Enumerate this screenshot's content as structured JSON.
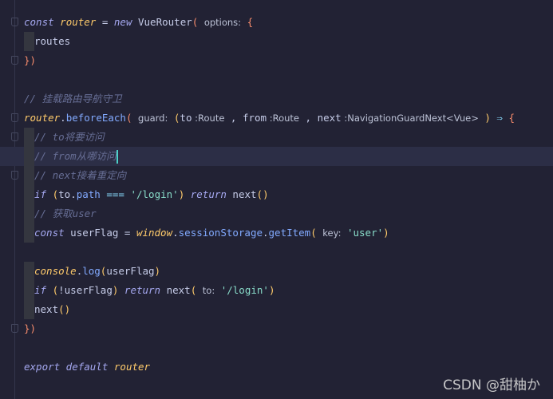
{
  "editor": {
    "lines": [
      {
        "indent": false,
        "fold": true,
        "tokens": [
          {
            "t": "const",
            "c": "kw"
          },
          {
            "t": " ",
            "c": "pl"
          },
          {
            "t": "router",
            "c": "var"
          },
          {
            "t": " = ",
            "c": "pl"
          },
          {
            "t": "new",
            "c": "kw"
          },
          {
            "t": " VueRouter",
            "c": "pl"
          },
          {
            "t": "( ",
            "c": "pn"
          },
          {
            "t": "options:",
            "c": "hint"
          },
          {
            "t": " {",
            "c": "pn"
          }
        ]
      },
      {
        "indent": true,
        "guide": true,
        "tokens": [
          {
            "t": "routes",
            "c": "pl"
          }
        ]
      },
      {
        "indent": false,
        "fold": true,
        "tokens": [
          {
            "t": "}",
            "c": "pn"
          },
          {
            "t": ")",
            "c": "pn"
          }
        ]
      },
      {
        "indent": false,
        "tokens": []
      },
      {
        "indent": false,
        "tokens": [
          {
            "t": "// 挂载路由导航守卫",
            "c": "cm"
          }
        ]
      },
      {
        "indent": false,
        "fold": true,
        "tokens": [
          {
            "t": "router",
            "c": "var"
          },
          {
            "t": ".",
            "c": "pl"
          },
          {
            "t": "beforeEach",
            "c": "fn"
          },
          {
            "t": "( ",
            "c": "pn"
          },
          {
            "t": "guard:",
            "c": "hint"
          },
          {
            "t": " (",
            "c": "pn2"
          },
          {
            "t": "to",
            "c": "pl"
          },
          {
            "t": " :Route",
            "c": "hint"
          },
          {
            "t": " , ",
            "c": "pl"
          },
          {
            "t": "from",
            "c": "pl"
          },
          {
            "t": " :Route",
            "c": "hint"
          },
          {
            "t": " , ",
            "c": "pl"
          },
          {
            "t": "next",
            "c": "pl"
          },
          {
            "t": " :NavigationGuardNext<Vue>",
            "c": "hint"
          },
          {
            "t": " ) ",
            "c": "pn2"
          },
          {
            "t": "⇒",
            "c": "op"
          },
          {
            "t": " {",
            "c": "pn"
          }
        ]
      },
      {
        "indent": true,
        "guide": true,
        "fold": true,
        "tokens": [
          {
            "t": "// to将要访问",
            "c": "cm"
          }
        ]
      },
      {
        "indent": true,
        "guide": true,
        "current": true,
        "caret": true,
        "tokens": [
          {
            "t": "// from从哪访问",
            "c": "cm"
          }
        ]
      },
      {
        "indent": true,
        "guide": true,
        "fold": true,
        "tokens": [
          {
            "t": "// next接着重定向",
            "c": "cm"
          }
        ]
      },
      {
        "indent": true,
        "guide": true,
        "tokens": [
          {
            "t": "if",
            "c": "kw"
          },
          {
            "t": " (",
            "c": "pn2"
          },
          {
            "t": "to",
            "c": "pl"
          },
          {
            "t": ".",
            "c": "pl"
          },
          {
            "t": "path",
            "c": "fn"
          },
          {
            "t": " === ",
            "c": "op"
          },
          {
            "t": "'/login'",
            "c": "str"
          },
          {
            "t": ")",
            "c": "pn2"
          },
          {
            "t": " ",
            "c": "pl"
          },
          {
            "t": "return",
            "c": "kw"
          },
          {
            "t": " next",
            "c": "pl"
          },
          {
            "t": "()",
            "c": "pn2"
          }
        ]
      },
      {
        "indent": true,
        "guide": true,
        "tokens": [
          {
            "t": "// 获取user",
            "c": "cm"
          }
        ]
      },
      {
        "indent": true,
        "guide": true,
        "tokens": [
          {
            "t": "const",
            "c": "kw"
          },
          {
            "t": " userFlag = ",
            "c": "pl"
          },
          {
            "t": "window",
            "c": "var"
          },
          {
            "t": ".",
            "c": "pl"
          },
          {
            "t": "sessionStorage",
            "c": "fn"
          },
          {
            "t": ".",
            "c": "pl"
          },
          {
            "t": "getItem",
            "c": "fn"
          },
          {
            "t": "( ",
            "c": "pn2"
          },
          {
            "t": "key:",
            "c": "hint"
          },
          {
            "t": " 'user'",
            "c": "str"
          },
          {
            "t": ")",
            "c": "pn2"
          }
        ]
      },
      {
        "indent": false,
        "tokens": []
      },
      {
        "indent": true,
        "guide": true,
        "tokens": [
          {
            "t": "console",
            "c": "var"
          },
          {
            "t": ".",
            "c": "pl"
          },
          {
            "t": "log",
            "c": "fn"
          },
          {
            "t": "(",
            "c": "pn2"
          },
          {
            "t": "userFlag",
            "c": "pl"
          },
          {
            "t": ")",
            "c": "pn2"
          }
        ]
      },
      {
        "indent": true,
        "guide": true,
        "tokens": [
          {
            "t": "if",
            "c": "kw"
          },
          {
            "t": " (",
            "c": "pn2"
          },
          {
            "t": "!userFlag",
            "c": "pl"
          },
          {
            "t": ")",
            "c": "pn2"
          },
          {
            "t": " ",
            "c": "pl"
          },
          {
            "t": "return",
            "c": "kw"
          },
          {
            "t": " next",
            "c": "pl"
          },
          {
            "t": "( ",
            "c": "pn2"
          },
          {
            "t": "to:",
            "c": "hint"
          },
          {
            "t": " '/login'",
            "c": "str"
          },
          {
            "t": ")",
            "c": "pn2"
          }
        ]
      },
      {
        "indent": true,
        "guide": true,
        "tokens": [
          {
            "t": "next",
            "c": "pl"
          },
          {
            "t": "()",
            "c": "pn2"
          }
        ]
      },
      {
        "indent": false,
        "fold": true,
        "tokens": [
          {
            "t": "}",
            "c": "pn"
          },
          {
            "t": ")",
            "c": "pn"
          }
        ]
      },
      {
        "indent": false,
        "tokens": []
      },
      {
        "indent": false,
        "tokens": [
          {
            "t": "export default",
            "c": "kw"
          },
          {
            "t": " ",
            "c": "pl"
          },
          {
            "t": "router",
            "c": "var"
          }
        ]
      }
    ]
  },
  "watermark": "CSDN @甜柚か"
}
